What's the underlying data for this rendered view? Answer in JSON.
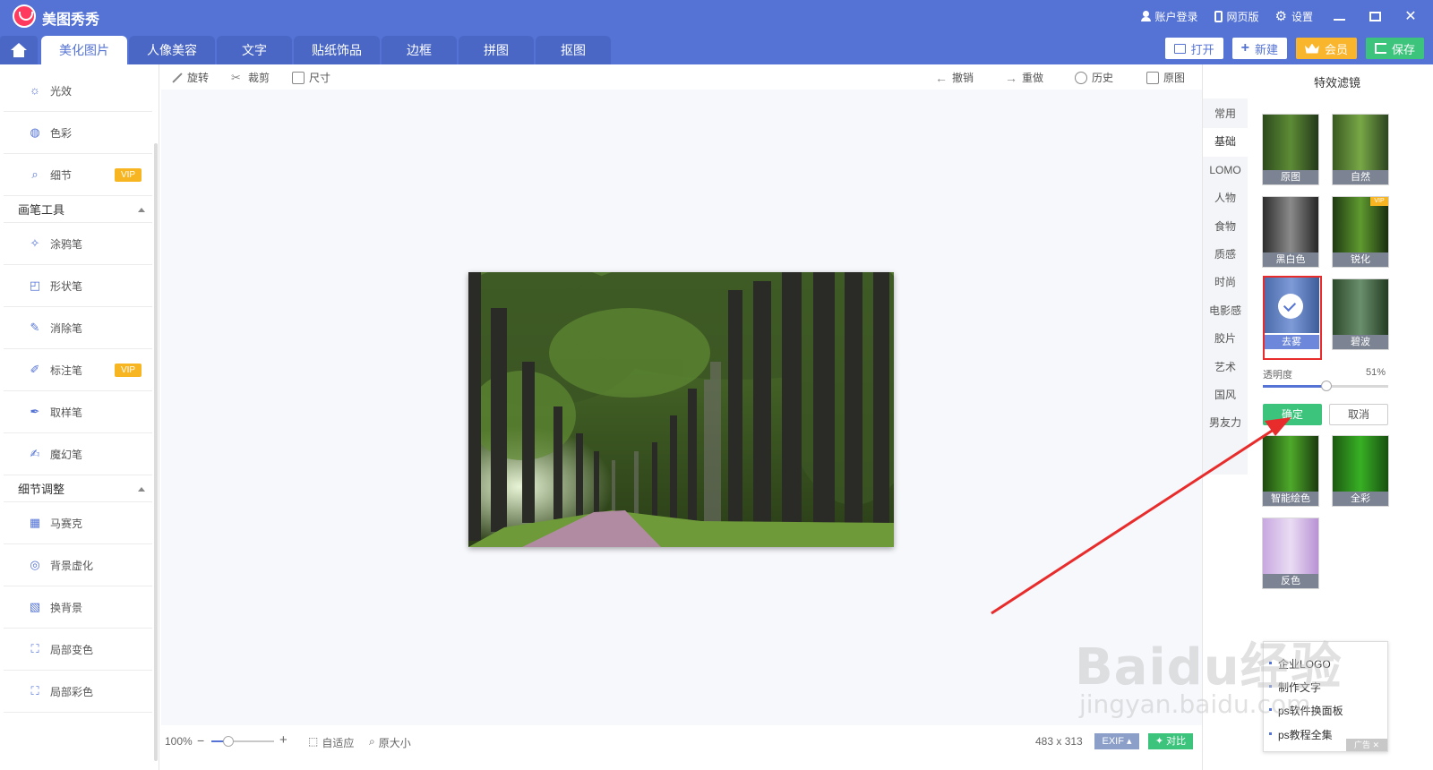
{
  "app": {
    "title": "美图秀秀"
  },
  "top_links": {
    "login": "账户登录",
    "web": "网页版",
    "settings": "设置"
  },
  "tabs": [
    {
      "label": "美化图片",
      "active": true
    },
    {
      "label": "人像美容",
      "active": false
    },
    {
      "label": "文字",
      "active": false
    },
    {
      "label": "贴纸饰品",
      "active": false
    },
    {
      "label": "边框",
      "active": false
    },
    {
      "label": "拼图",
      "active": false
    },
    {
      "label": "抠图",
      "active": false
    }
  ],
  "actions": {
    "open": "打开",
    "new": "新建",
    "vip": "会员",
    "save": "保存"
  },
  "sidebar": {
    "items_top": [
      {
        "label": "光效",
        "icon": "sun-icon",
        "vip": false
      },
      {
        "label": "色彩",
        "icon": "palette-icon",
        "vip": false
      },
      {
        "label": "细节",
        "icon": "magnifier-icon",
        "vip": true
      }
    ],
    "section_brush": "画笔工具",
    "brush_items": [
      {
        "label": "涂鸦笔",
        "icon": "doodle-pen-icon",
        "vip": false
      },
      {
        "label": "形状笔",
        "icon": "shape-pen-icon",
        "vip": false
      },
      {
        "label": "消除笔",
        "icon": "eraser-pen-icon",
        "vip": false
      },
      {
        "label": "标注笔",
        "icon": "marker-pen-icon",
        "vip": true
      },
      {
        "label": "取样笔",
        "icon": "eyedropper-icon",
        "vip": false
      },
      {
        "label": "魔幻笔",
        "icon": "magic-pen-icon",
        "vip": false
      }
    ],
    "section_detail": "细节调整",
    "detail_items": [
      {
        "label": "马赛克",
        "icon": "mosaic-icon"
      },
      {
        "label": "背景虚化",
        "icon": "blur-icon"
      },
      {
        "label": "换背景",
        "icon": "background-icon"
      },
      {
        "label": "局部变色",
        "icon": "local-color-icon"
      },
      {
        "label": "局部彩色",
        "icon": "local-colorful-icon"
      }
    ],
    "vip_label": "VIP"
  },
  "canvas_toolbar": {
    "rotate": "旋转",
    "crop": "裁剪",
    "size": "尺寸",
    "undo": "撤销",
    "redo": "重做",
    "history": "历史",
    "original": "原图"
  },
  "status": {
    "zoom": "100%",
    "zoom_level": 0.27,
    "fit": "自适应",
    "actual": "原大小",
    "dimensions": "483 x 313",
    "exif": "EXIF",
    "compare": "对比"
  },
  "right_panel": {
    "title": "特效滤镜",
    "categories": [
      "常用",
      "基础",
      "LOMO",
      "人物",
      "食物",
      "质感",
      "时尚",
      "电影感",
      "胶片",
      "艺术",
      "国风",
      "男友力"
    ],
    "active_category": "基础",
    "filters": [
      {
        "label": "原图",
        "vip": false
      },
      {
        "label": "自然",
        "vip": false
      },
      {
        "label": "黑白色",
        "vip": false
      },
      {
        "label": "锐化",
        "vip": true
      },
      {
        "label": "去雾",
        "vip": false,
        "selected": true
      },
      {
        "label": "碧波",
        "vip": false
      },
      {
        "label": "智能绘色",
        "vip": false
      },
      {
        "label": "全彩",
        "vip": false
      },
      {
        "label": "反色",
        "vip": false
      }
    ],
    "opacity_label": "透明度",
    "opacity_value": "51%",
    "opacity_level": 0.51,
    "ok": "确定",
    "cancel": "取消",
    "mini_vip": "VIP"
  },
  "ad": {
    "items": [
      "企业LOGO",
      "制作文字",
      "ps软件换面板",
      "ps教程全集"
    ],
    "tag": "广告"
  },
  "watermark": {
    "main": "Baidu经验",
    "sub": "jingyan.baidu.com"
  },
  "colors": {
    "primary": "#5473d4",
    "green": "#3cc47c",
    "gold": "#f9b52b",
    "red": "#e82c2c"
  }
}
